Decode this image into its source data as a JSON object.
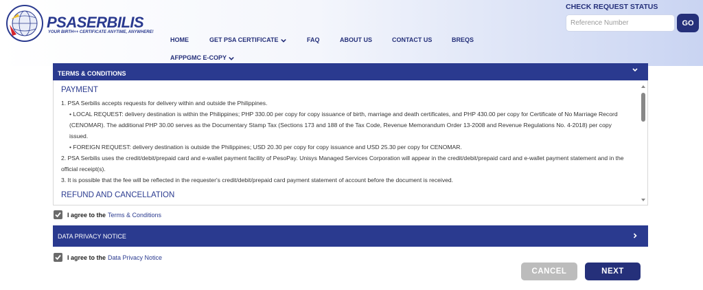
{
  "brand": {
    "name_psa": "PSA",
    "name_rest": "SERBILIS",
    "tagline": "YOUR BIRTH++ CERTIFICATE ANYTIME, ANYWHERE!",
    "seal_icon": "psa-seal-icon"
  },
  "nav": {
    "items": [
      {
        "label": "HOME"
      },
      {
        "label": "GET PSA CERTIFICATE",
        "has_dropdown": true
      },
      {
        "label": "FAQ"
      },
      {
        "label": "ABOUT US"
      },
      {
        "label": "CONTACT US"
      },
      {
        "label": "BREQS"
      },
      {
        "label": "AFPPGMC E-COPY",
        "has_dropdown": true
      }
    ]
  },
  "check_status": {
    "title": "CHECK REQUEST STATUS",
    "placeholder": "Reference Number",
    "go_label": "GO"
  },
  "terms": {
    "bar_title": "TERMS & CONDITIONS",
    "payment_title": "PAYMENT",
    "p1": "1. PSA Serbilis accepts requests for delivery within and outside the Philippines.",
    "local": "• LOCAL REQUEST: delivery destination is within the Philippines; PHP 330.00 per copy for copy issuance of birth, marriage and death certificates, and PHP 430.00 per copy for Certificate of No Marriage Record (CENOMAR). The additional PHP 30.00 serves as the Documentary Stamp Tax (Sections 173 and 188 of the Tax Code, Revenue Memorandum Order 13-2008 and Revenue Regulations No. 4-2018) per copy issued.",
    "foreign": "• FOREIGN REQUEST: delivery destination is outside the Philippines; USD 20.30 per copy for copy issuance and USD 25.30 per copy for CENOMAR.",
    "p2": "2. PSA Serbilis uses the credit/debit/prepaid card and e-wallet payment facility of PesoPay. Unisys Managed Services Corporation will appear in the credit/debit/prepaid card and e-wallet payment statement and in the official receipt(s).",
    "p3": "3. It is possible that the fee will be reflected in the requester's credit/debit/prepaid card payment statement of account before the document is received.",
    "refund_title": "REFUND AND CANCELLATION",
    "agree_prefix": "I agree to the",
    "agree_link": "Terms & Conditions",
    "agreed": true
  },
  "privacy": {
    "bar_title": "DATA PRIVACY NOTICE",
    "agree_prefix": "I agree to the",
    "agree_link": "Data Privacy Notice",
    "agreed": true
  },
  "actions": {
    "cancel_label": "CANCEL",
    "next_label": "NEXT"
  },
  "colors": {
    "brand_blue": "#2a3a8f",
    "nav_blue": "#25307a",
    "cancel_gray": "#bcbcbc"
  }
}
